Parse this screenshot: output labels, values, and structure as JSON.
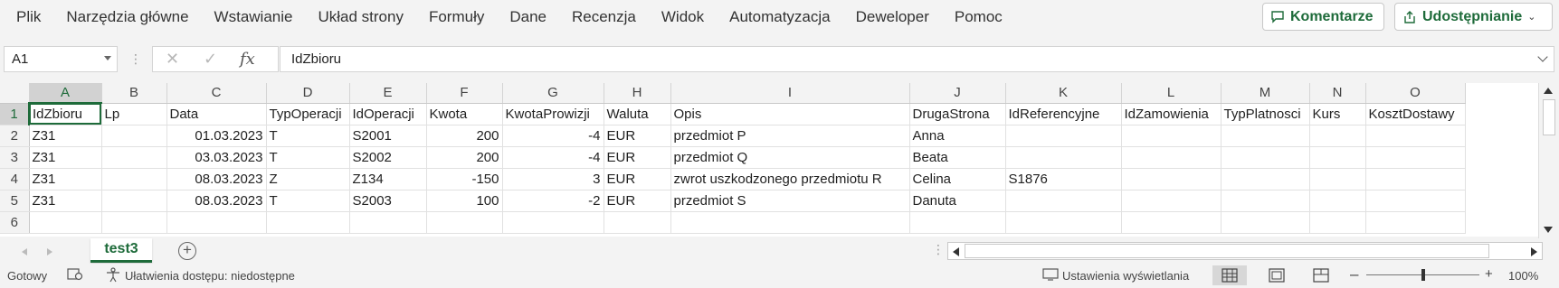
{
  "menu": [
    "Plik",
    "Narzędzia główne",
    "Wstawianie",
    "Układ strony",
    "Formuły",
    "Dane",
    "Recenzja",
    "Widok",
    "Automatyzacja",
    "Deweloper",
    "Pomoc"
  ],
  "ribbon_buttons": {
    "comments": "Komentarze",
    "share": "Udostępnianie"
  },
  "formula_bar": {
    "name_box": "A1",
    "fx": "fx",
    "content": "IdZbioru"
  },
  "columns": [
    "A",
    "B",
    "C",
    "D",
    "E",
    "F",
    "G",
    "H",
    "I",
    "J",
    "K",
    "L",
    "M",
    "N",
    "O"
  ],
  "rows": [
    {
      "n": "1",
      "cells": [
        "IdZbioru",
        "Lp",
        "Data",
        "TypOperacji",
        "IdOperacji",
        "Kwota",
        "KwotaProwizji",
        "Waluta",
        "Opis",
        "DrugaStrona",
        "IdReferencyjne",
        "IdZamowienia",
        "TypPlatnosci",
        "Kurs",
        "KosztDostawy"
      ]
    },
    {
      "n": "2",
      "cells": [
        "Z31",
        "",
        "01.03.2023",
        "T",
        "S2001",
        "200",
        "-4",
        "EUR",
        "przedmiot P",
        "Anna",
        "",
        "",
        "",
        "",
        ""
      ]
    },
    {
      "n": "3",
      "cells": [
        "Z31",
        "",
        "03.03.2023",
        "T",
        "S2002",
        "200",
        "-4",
        "EUR",
        "przedmiot Q",
        "Beata",
        "",
        "",
        "",
        "",
        ""
      ]
    },
    {
      "n": "4",
      "cells": [
        "Z31",
        "",
        "08.03.2023",
        "Z",
        "Z134",
        "-150",
        "3",
        "EUR",
        "zwrot uszkodzonego przedmiotu R",
        "Celina",
        "S1876",
        "",
        "",
        "",
        ""
      ]
    },
    {
      "n": "5",
      "cells": [
        "Z31",
        "",
        "08.03.2023",
        "T",
        "S2003",
        "100",
        "-2",
        "EUR",
        "przedmiot S",
        "Danuta",
        "",
        "",
        "",
        "",
        ""
      ]
    },
    {
      "n": "6",
      "cells": [
        "",
        "",
        "",
        "",
        "",
        "",
        "",
        "",
        "",
        "",
        "",
        "",
        "",
        "",
        ""
      ]
    }
  ],
  "sheet_tab": "test3",
  "status": {
    "ready": "Gotowy",
    "accessibility": "Ułatwienia dostępu: niedostępne",
    "display_settings": "Ustawienia wyświetlania",
    "zoom": "100%"
  },
  "colors": {
    "accent": "#1e6b3a"
  }
}
